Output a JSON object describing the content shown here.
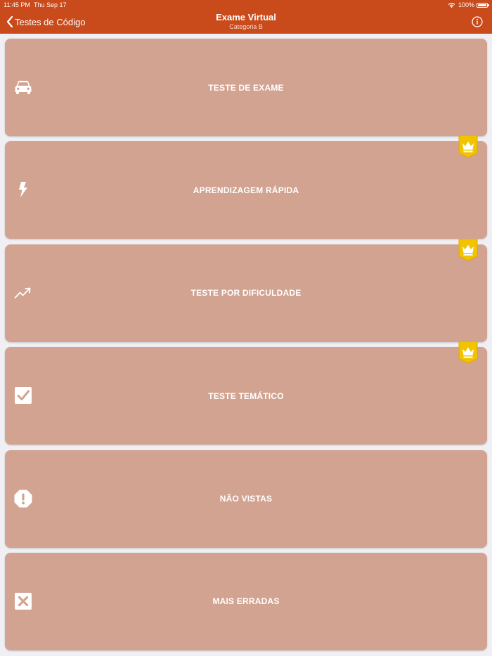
{
  "status_bar": {
    "time": "11:45 PM",
    "date": "Thu Sep 17",
    "battery": "100%"
  },
  "nav": {
    "back_label": "Testes de Código",
    "title": "Exame Virtual",
    "subtitle": "Categoria B"
  },
  "colors": {
    "header": "#c94a1b",
    "card": "#d2a391",
    "badge": "#f2c400"
  },
  "menu": {
    "items": [
      {
        "label": "TESTE DE EXAME",
        "icon": "car-icon",
        "premium": false
      },
      {
        "label": "APRENDIZAGEM RÁPIDA",
        "icon": "lightning-icon",
        "premium": true
      },
      {
        "label": "TESTE POR DIFICULDADE",
        "icon": "trend-up-icon",
        "premium": true
      },
      {
        "label": "TESTE TEMÁTICO",
        "icon": "checkbox-icon",
        "premium": true
      },
      {
        "label": "NÃO VISTAS",
        "icon": "alert-octagon-icon",
        "premium": false
      },
      {
        "label": "MAIS ERRADAS",
        "icon": "x-box-icon",
        "premium": false
      }
    ]
  }
}
